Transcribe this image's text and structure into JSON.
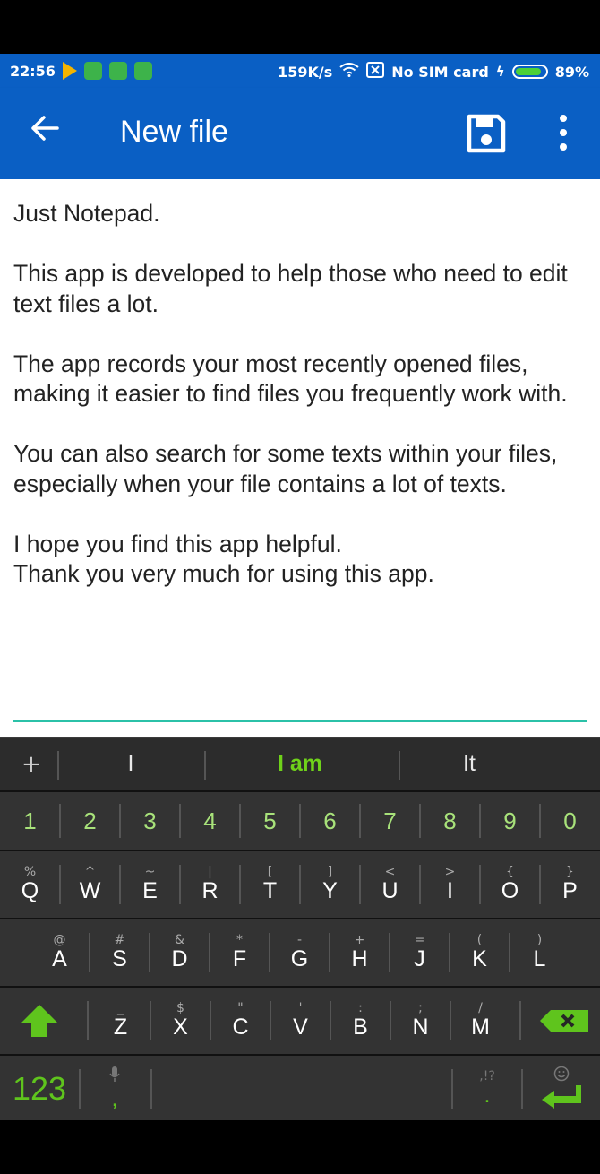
{
  "status": {
    "time": "22:56",
    "speed": "159K/s",
    "sim": "No SIM card",
    "battery_pct": "89%",
    "battery_level": 0.89
  },
  "appbar": {
    "title": "New file",
    "back_icon": "arrow-left-icon",
    "save_icon": "floppy-disk-icon",
    "menu_icon": "more-vert-icon"
  },
  "editor": {
    "text": "Just Notepad.\n\nThis app is developed to help those who need to edit text files a lot.\n\nThe app records your most recently opened files, making it easier to find files you frequently work with.\n\nYou can also search for some texts within your files, especially when your file contains a lot of texts.\n\nI hope you find this app helpful.\nThank you very much for using this app."
  },
  "keyboard": {
    "suggestions": {
      "plus": "+",
      "left": "I",
      "center": "I am",
      "right": "It"
    },
    "numbers": [
      "1",
      "2",
      "3",
      "4",
      "5",
      "6",
      "7",
      "8",
      "9",
      "0"
    ],
    "row1": [
      {
        "main": "Q",
        "sub": "%"
      },
      {
        "main": "W",
        "sub": "^"
      },
      {
        "main": "E",
        "sub": "~"
      },
      {
        "main": "R",
        "sub": "|"
      },
      {
        "main": "T",
        "sub": "["
      },
      {
        "main": "Y",
        "sub": "]"
      },
      {
        "main": "U",
        "sub": "<"
      },
      {
        "main": "I",
        "sub": ">"
      },
      {
        "main": "O",
        "sub": "{"
      },
      {
        "main": "P",
        "sub": "}"
      }
    ],
    "row2": [
      {
        "main": "A",
        "sub": "@"
      },
      {
        "main": "S",
        "sub": "#"
      },
      {
        "main": "D",
        "sub": "&"
      },
      {
        "main": "F",
        "sub": "*"
      },
      {
        "main": "G",
        "sub": "-"
      },
      {
        "main": "H",
        "sub": "+"
      },
      {
        "main": "J",
        "sub": "="
      },
      {
        "main": "K",
        "sub": "("
      },
      {
        "main": "L",
        "sub": ")"
      }
    ],
    "row3": [
      {
        "main": "Z",
        "sub": "_"
      },
      {
        "main": "X",
        "sub": "$"
      },
      {
        "main": "C",
        "sub": "\""
      },
      {
        "main": "V",
        "sub": "'"
      },
      {
        "main": "B",
        "sub": ":"
      },
      {
        "main": "N",
        "sub": ";"
      },
      {
        "main": "M",
        "sub": "/"
      }
    ],
    "bottom": {
      "mode_key": "123",
      "comma": ",",
      "period": ".",
      "period_sub": ",!?"
    }
  }
}
